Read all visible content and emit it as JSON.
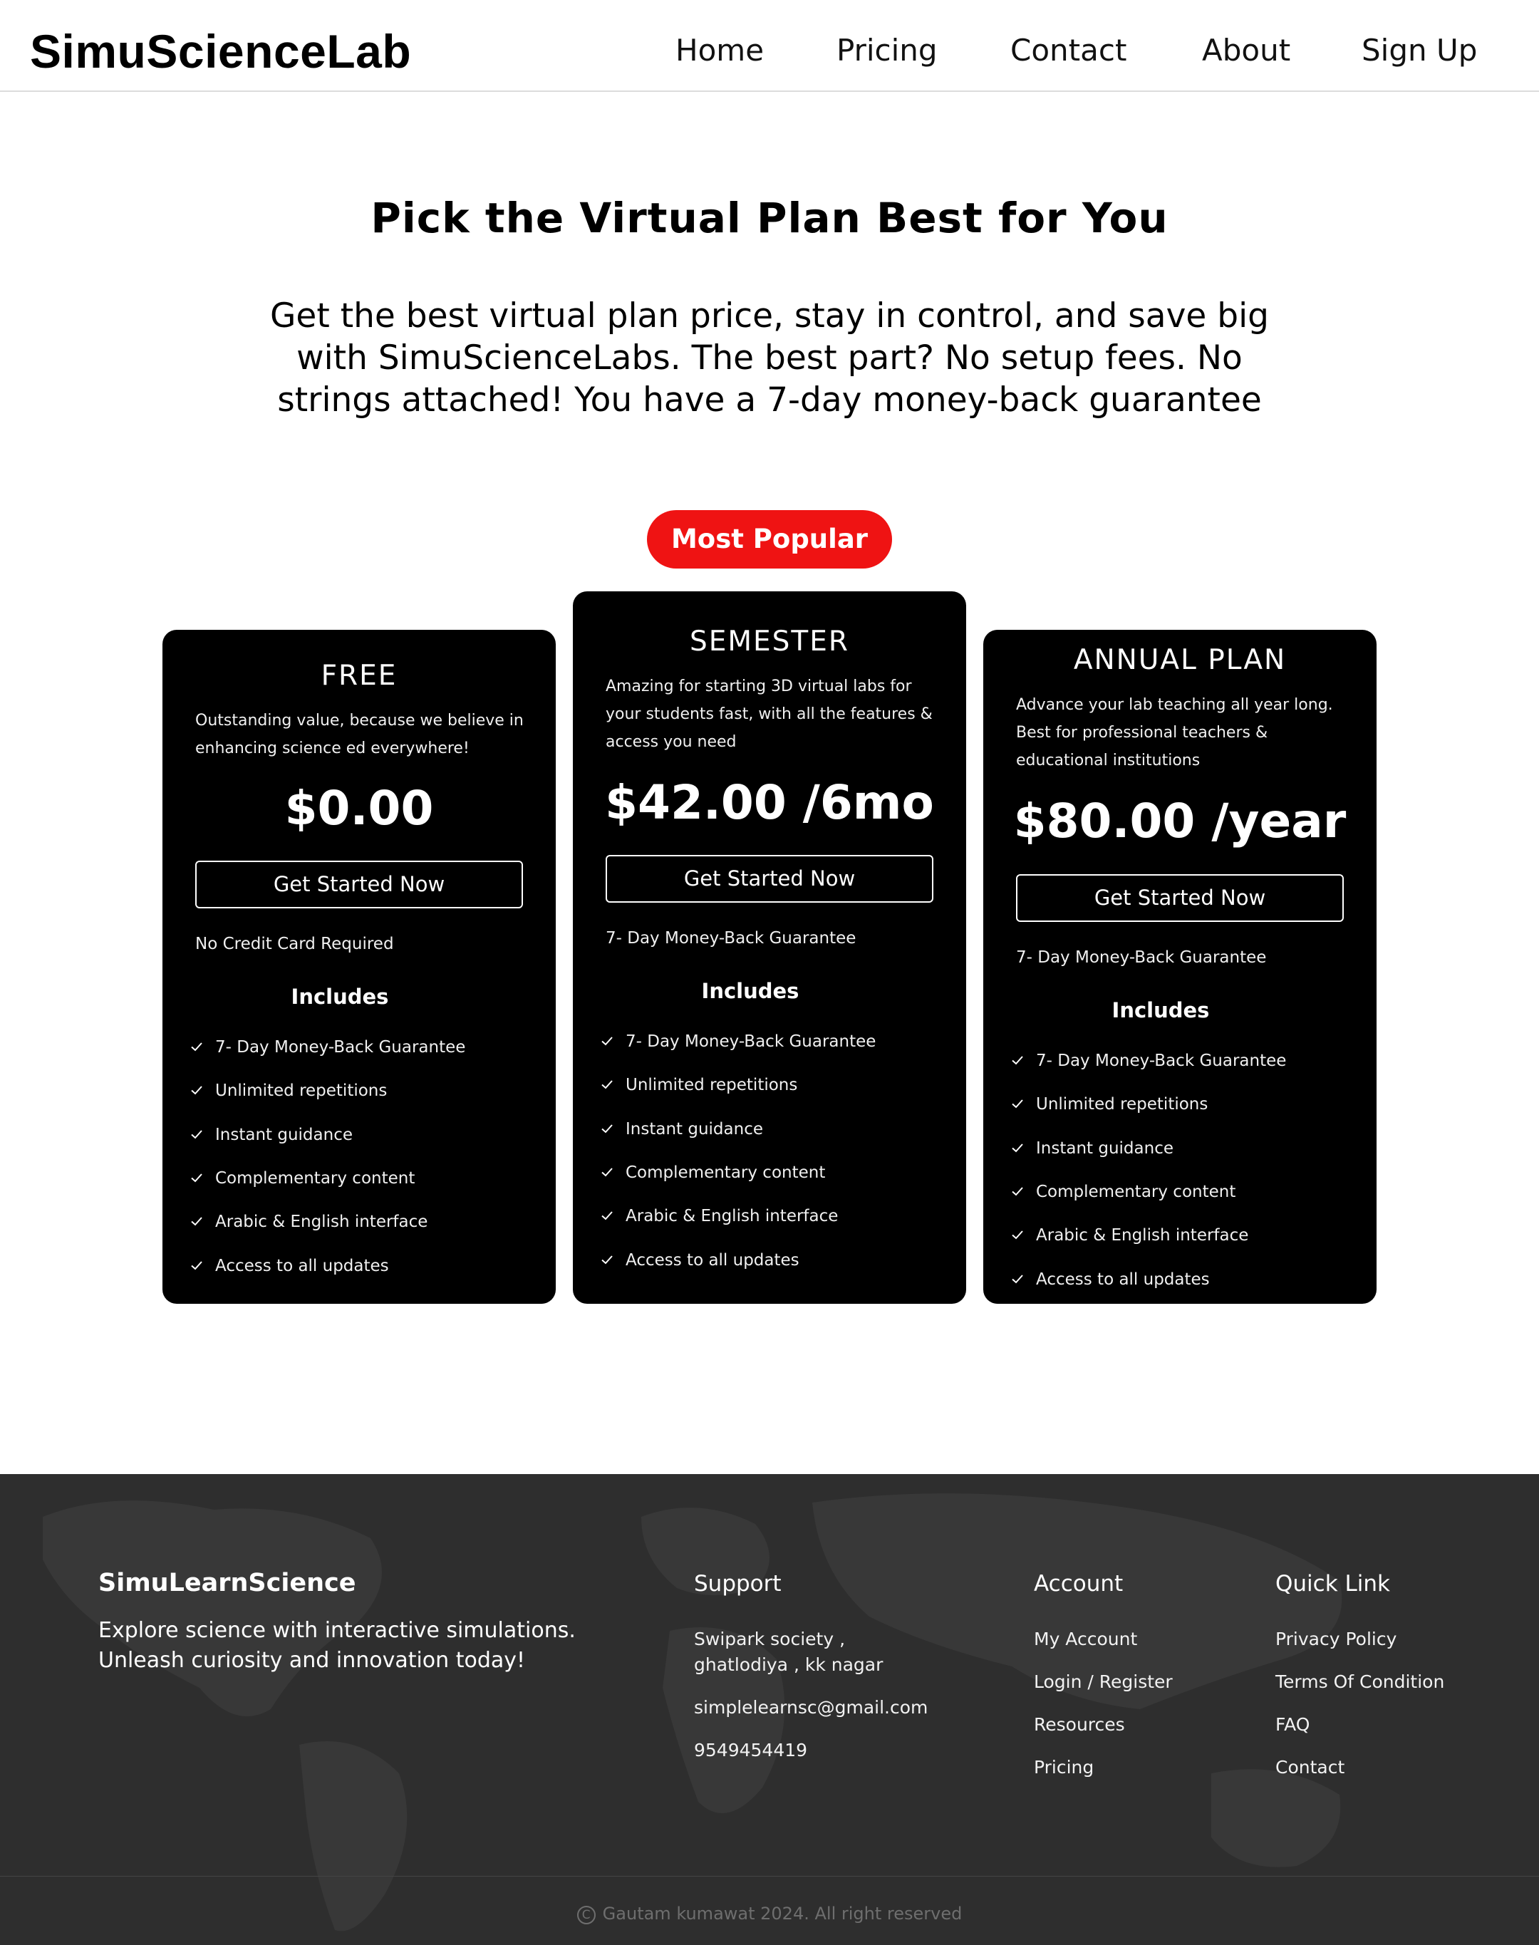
{
  "header": {
    "logo": "SimuScienceLab",
    "nav": [
      "Home",
      "Pricing",
      "Contact",
      "About",
      "Sign Up"
    ]
  },
  "hero": {
    "title": "Pick the Virtual Plan Best for You",
    "subtitle": "Get the best virtual plan price, stay in control, and save big with SimuScienceLabs. The best part? No setup fees. No strings attached! You have a 7-day money-back guarantee"
  },
  "badge": "Most Popular",
  "colors": {
    "accent": "#ef1313",
    "card_bg": "#000000",
    "footer_bg": "#2e2e2e"
  },
  "plans": [
    {
      "name": "FREE",
      "description": "Outstanding value, because we believe in enhancing science ed everywhere!",
      "price": "$0.00",
      "button": "Get Started Now",
      "note": "No Credit Card Required",
      "includes_label": "Includes",
      "features": [
        "7- Day Money-Back Guarantee",
        "Unlimited repetitions",
        "Instant guidance",
        "Complementary content",
        "Arabic & English interface",
        "Access to all updates"
      ]
    },
    {
      "name": "SEMESTER",
      "description": "Amazing for starting 3D virtual labs for your students fast, with all the features & access you need",
      "price": "$42.00 /6mo",
      "button": "Get Started Now",
      "note": "7- Day Money-Back Guarantee",
      "includes_label": "Includes",
      "features": [
        "7- Day Money-Back Guarantee",
        "Unlimited repetitions",
        "Instant guidance",
        "Complementary content",
        "Arabic & English interface",
        "Access to all updates"
      ]
    },
    {
      "name": "ANNUAL PLAN",
      "description": "Advance your lab teaching all year long. Best for professional teachers & educational institutions",
      "price": "$80.00 /year",
      "button": "Get Started Now",
      "note": "7- Day Money-Back Guarantee",
      "includes_label": "Includes",
      "features": [
        "7- Day Money-Back Guarantee",
        "Unlimited repetitions",
        "Instant guidance",
        "Complementary content",
        "Arabic & English interface",
        "Access to all updates"
      ]
    }
  ],
  "footer": {
    "brand": "SimuLearnScience",
    "tagline": "Explore science with interactive simulations. Unleash curiosity and innovation today!",
    "support": {
      "heading": "Support",
      "address_line1": "Swipark society ,",
      "address_line2": "ghatlodiya , kk nagar",
      "email": "simplelearnsc@gmail.com",
      "phone": "9549454419"
    },
    "account": {
      "heading": "Account",
      "links": [
        "My Account",
        "Login / Register",
        "Resources",
        "Pricing"
      ]
    },
    "quick_link": {
      "heading": "Quick Link",
      "links": [
        "Privacy Policy",
        "Terms Of Condition",
        "FAQ",
        "Contact"
      ]
    },
    "copyright": "Gautam kumawat 2024. All right reserved"
  }
}
